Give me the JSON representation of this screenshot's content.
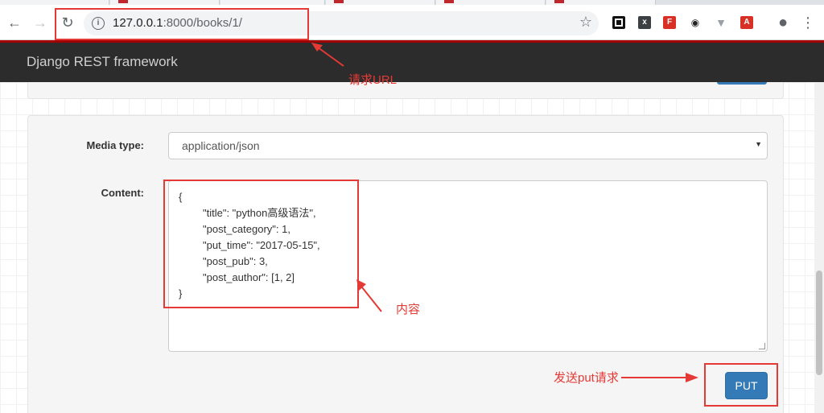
{
  "browser": {
    "url_host": "127.0.0.1",
    "url_rest": ":8000/books/1/"
  },
  "app": {
    "brand": "Django REST framework"
  },
  "form": {
    "media_type_label": "Media type:",
    "media_type_value": "application/json",
    "content_label": "Content:",
    "content_lines": [
      "{",
      "\"title\": \"python高级语法\",",
      "\"post_category\": 1,",
      "\"put_time\": \"2017-05-15\",",
      "\"post_pub\": 3,",
      "\"post_author\": [1, 2]",
      "}"
    ],
    "put_label": "PUT"
  },
  "annotations": {
    "url_note": "请求URL",
    "content_note": "内容",
    "put_note": "发送put请求"
  },
  "colors": {
    "annotation": "#e53935",
    "navbar": "#2c2c2c",
    "navbar_accent": "#a30000",
    "button": "#337ab7"
  },
  "icons": [
    "back-icon",
    "forward-icon",
    "reload-icon",
    "info-icon",
    "star-icon",
    "account-icon",
    "menu-icon",
    "caret-down-icon"
  ]
}
